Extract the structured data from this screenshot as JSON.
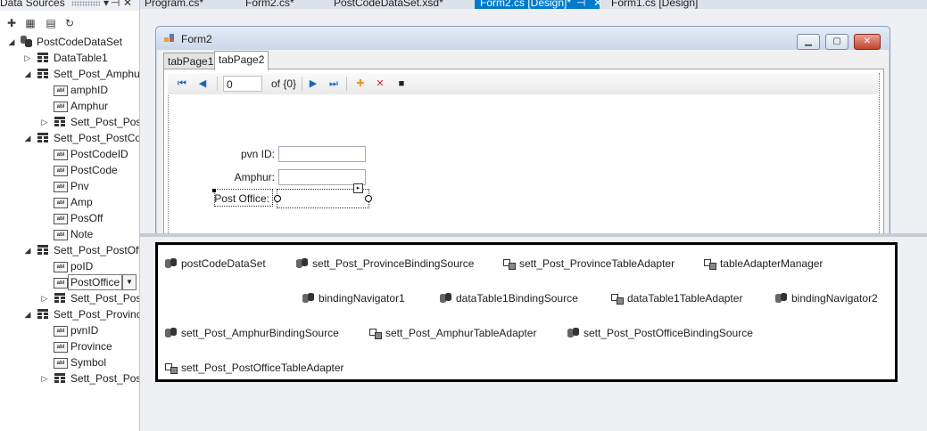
{
  "data_sources": {
    "title": "Data Sources",
    "header_buttons": [
      "▾",
      "⊣",
      "✕"
    ],
    "toolbar_icons": [
      "add-data-source-icon",
      "edit-dataset-icon",
      "configure-icon",
      "refresh-icon"
    ],
    "tree": {
      "root": "PostCodeDataSet",
      "datatable1": "DataTable1",
      "amphur": {
        "label": "Sett_Post_Amphur",
        "fields": [
          "amphID",
          "Amphur"
        ],
        "child": "Sett_Post_Post"
      },
      "postcode": {
        "label": "Sett_Post_PostCo",
        "fields": [
          "PostCodeID",
          "PostCode",
          "Pnv",
          "Amp",
          "PosOff",
          "Note"
        ]
      },
      "postoffice": {
        "label": "Sett_Post_PostOff",
        "fields": [
          "poID"
        ],
        "selected_field": "PostOffice",
        "child": "Sett_Post_Post"
      },
      "province": {
        "label": "Sett_Post_Provinc",
        "fields": [
          "pvnID",
          "Province",
          "Symbol"
        ],
        "child": "Sett_Post_Post"
      }
    }
  },
  "doc_tabs": [
    "Program.cs*",
    "Form2.cs*",
    "PostCodeDataSet.xsd*",
    "Form2.cs [Design]*",
    "Form1.cs [Design]"
  ],
  "active_tab_icons": [
    "⊣",
    "✕"
  ],
  "form": {
    "title": "Form2",
    "tabs": [
      "tabPage1",
      "tabPage2"
    ],
    "navigator": {
      "position": "0",
      "count": "of {0}"
    },
    "labels": {
      "pvn": "pvn ID:",
      "amphur": "Amphur:",
      "post_office": "Post Office:"
    }
  },
  "tray_components": [
    {
      "name": "postCodeDataSet",
      "icon": "dataset-icon"
    },
    {
      "name": "sett_Post_ProvinceBindingSource",
      "icon": "binding-source-icon"
    },
    {
      "name": "sett_Post_ProvinceTableAdapter",
      "icon": "table-adapter-icon"
    },
    {
      "name": "tableAdapterManager",
      "icon": "table-adapter-icon"
    },
    {
      "name": "bindingNavigator1",
      "icon": "binding-source-icon"
    },
    {
      "name": "dataTable1BindingSource",
      "icon": "binding-source-icon"
    },
    {
      "name": "dataTable1TableAdapter",
      "icon": "table-adapter-icon"
    },
    {
      "name": "bindingNavigator2",
      "icon": "binding-source-icon"
    },
    {
      "name": "sett_Post_AmphurBindingSource",
      "icon": "binding-source-icon"
    },
    {
      "name": "sett_Post_AmphurTableAdapter",
      "icon": "table-adapter-icon"
    },
    {
      "name": "sett_Post_PostOfficeBindingSource",
      "icon": "binding-source-icon"
    },
    {
      "name": "sett_Post_PostOfficeTableAdapter",
      "icon": "table-adapter-icon"
    }
  ]
}
